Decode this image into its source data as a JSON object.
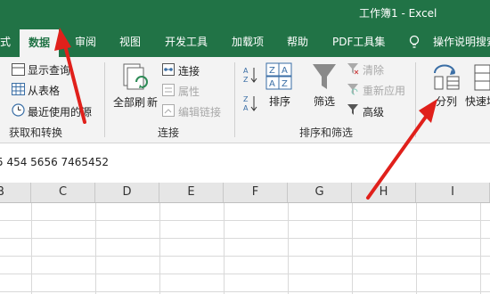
{
  "window": {
    "title": "工作簿1  -  Excel"
  },
  "tabs": [
    "式",
    "数据",
    "审阅",
    "视图",
    "开发工具",
    "加载项",
    "帮助",
    "PDF工具集",
    "操作说明搜索"
  ],
  "ribbon": {
    "get_transform": {
      "show_queries": "显示查询",
      "from_table": "从表格",
      "recent_sources": "最近使用的源",
      "group_label": "获取和转换"
    },
    "connections": {
      "refresh_all_line1": "全部刷",
      "refresh_all_line2": "新",
      "connections": "连接",
      "properties": "属性",
      "edit_links": "编辑链接",
      "group_label": "连接"
    },
    "sort_filter": {
      "sort": "排序",
      "filter": "筛选",
      "clear": "清除",
      "reapply": "重新应用",
      "advanced": "高级",
      "group_label": "排序和筛选"
    },
    "data_tools": {
      "text_to_columns": "分列",
      "flash_fill": "快速填"
    }
  },
  "formula_bar": {
    "content": "5 454 5656 7465452"
  },
  "columns": [
    "B",
    "C",
    "D",
    "E",
    "F",
    "G",
    "H",
    "I"
  ],
  "colors": {
    "excel_green": "#217346",
    "annotation_red": "#e0201b"
  },
  "icons": [
    "table-icon",
    "clock-icon",
    "refresh-all-icon",
    "connections-icon",
    "properties-icon",
    "edit-links-icon",
    "sort-az-icon",
    "sort-za-icon",
    "sort-icon",
    "filter-icon",
    "clear-icon",
    "reapply-icon",
    "advanced-icon",
    "text-to-columns-icon",
    "flash-fill-icon",
    "lightbulb-icon",
    "arrow-annotation"
  ]
}
